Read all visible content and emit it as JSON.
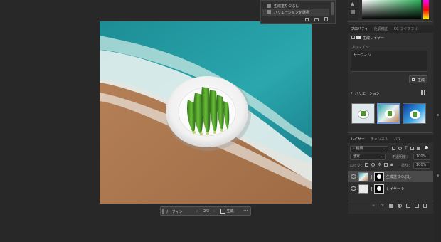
{
  "history": {
    "items": [
      {
        "label": "生成塗りつぶし"
      },
      {
        "label": "バリエーションを選択"
      }
    ]
  },
  "properties": {
    "tabs": [
      {
        "label": "プロパティ"
      },
      {
        "label": "色調補正"
      },
      {
        "label": "CC ライブラリ"
      }
    ],
    "layer_type": "生成レイヤー",
    "prompt_label": "プロンプト：",
    "prompt_text": "サーフィン",
    "generate_label": "生成",
    "variations_label": "バリエーション"
  },
  "layers": {
    "tabs": [
      {
        "label": "レイヤー"
      },
      {
        "label": "チャンネル"
      },
      {
        "label": "パス"
      }
    ],
    "filter_kind": "種類",
    "blend_mode": "通常",
    "opacity_label": "不透明度：",
    "opacity_value": "100%",
    "lock_label": "ロック：",
    "fill_label": "塗り：",
    "fill_value": "100%",
    "items": [
      {
        "name": "生成塗りつぶし"
      },
      {
        "name": "レイヤー 0"
      }
    ]
  },
  "context_bar": {
    "prompt": "サーフィン",
    "counter": "2/3",
    "generate_label": "生成"
  },
  "colors": {
    "panel_bg": "#2f2f2f",
    "workspace_bg": "#282828",
    "selection": "#4b6b9a"
  }
}
